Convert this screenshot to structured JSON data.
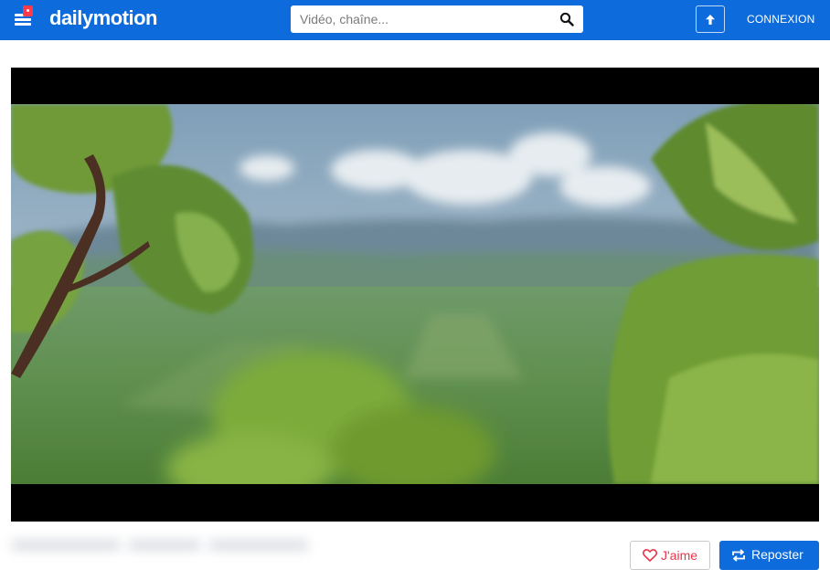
{
  "header": {
    "logo_text": "dailymotion",
    "search_placeholder": "Vidéo, chaîne...",
    "login_label": "CONNEXION",
    "brand_color": "#0d6bdc",
    "notification_color": "#ff3b4a",
    "icons": [
      "menu-icon",
      "search-icon",
      "upload-icon"
    ]
  },
  "player": {
    "content": "video frame: blurred vineyard landscape framed by grape leaves"
  },
  "actions": {
    "like_label": "J'aime",
    "repost_label": "Reposter",
    "like_color": "#e8364b",
    "icons": [
      "heart-icon",
      "repost-icon"
    ]
  }
}
